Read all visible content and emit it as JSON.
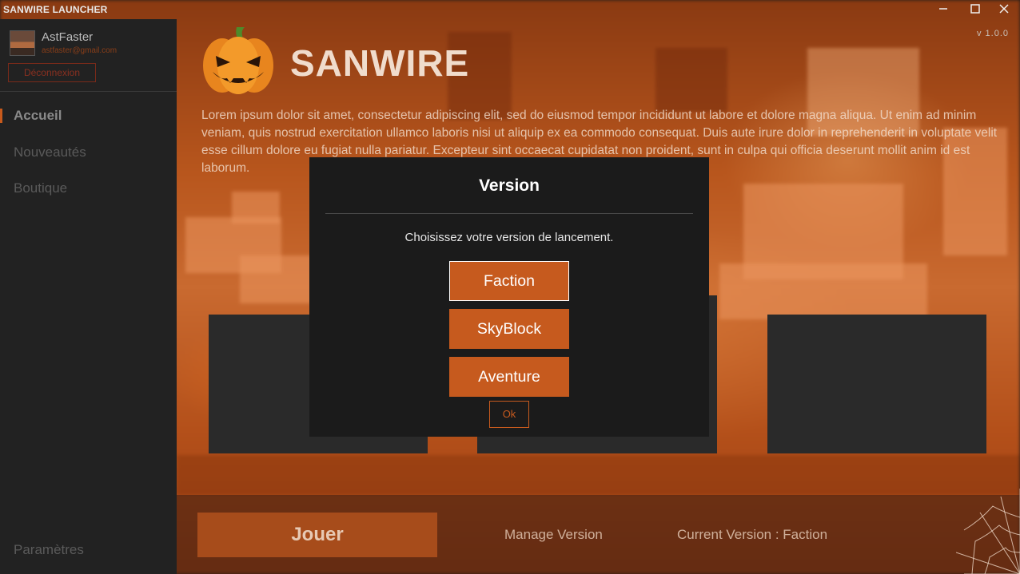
{
  "window": {
    "title": "SANWIRE LAUNCHER",
    "minimize_icon": "minimize-icon",
    "maximize_icon": "maximize-icon",
    "close_icon": "close-icon"
  },
  "sidebar": {
    "user": {
      "name": "AstFaster",
      "email": "astfaster@gmail.com",
      "logout_label": "Déconnexion"
    },
    "nav": [
      {
        "label": "Accueil",
        "active": true
      },
      {
        "label": "Nouveautés"
      },
      {
        "label": "Boutique"
      }
    ],
    "settings_label": "Paramètres"
  },
  "main": {
    "brand_name": "SANWIRE",
    "app_version": "v 1.0.0",
    "description": "Lorem ipsum dolor sit amet, consectetur adipiscing elit, sed do eiusmod tempor incididunt ut labore et dolore magna aliqua. Ut enim ad minim veniam, quis nostrud exercitation ullamco laboris nisi ut aliquip ex ea commodo consequat. Duis aute irure dolor in reprehenderit in voluptate velit esse cillum dolore eu fugiat nulla pariatur. Excepteur sint occaecat cupidatat non proident, sunt in culpa qui officia deserunt mollit anim id est laborum."
  },
  "bottom_bar": {
    "play_label": "Jouer",
    "manage_version_label": "Manage Version",
    "current_version_label": "Current Version : Faction"
  },
  "modal": {
    "title": "Version",
    "message": "Choisissez votre version de lancement.",
    "options": [
      "Faction",
      "SkyBlock",
      "Aventure"
    ],
    "selected": "Faction",
    "ok_label": "Ok"
  },
  "colors": {
    "accent": "#c65a1e",
    "sidebar_bg": "#222222",
    "modal_bg": "#1b1b1b"
  }
}
